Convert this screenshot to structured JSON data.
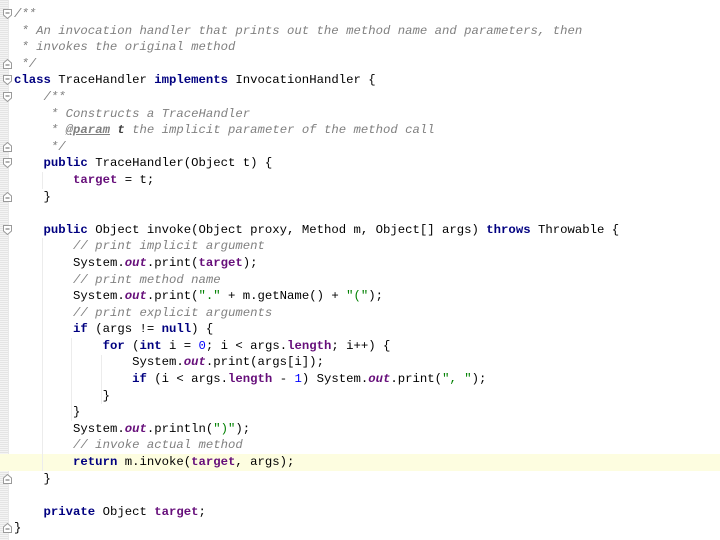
{
  "editor": {
    "language": "java",
    "highlighted_line": 27,
    "colors": {
      "keyword": "#000080",
      "field": "#660e7a",
      "comment": "#808080",
      "string": "#008000",
      "number": "#0000ff",
      "current_line": "#fdfde0"
    },
    "lines": [
      {
        "indent": 0,
        "fold": "open",
        "tokens": [
          {
            "t": "cmt",
            "v": "/**"
          }
        ]
      },
      {
        "indent": 0,
        "fold": "",
        "tokens": [
          {
            "t": "cmt",
            "v": " * An invocation handler that prints out the method name and parameters, then"
          }
        ]
      },
      {
        "indent": 0,
        "fold": "",
        "tokens": [
          {
            "t": "cmt",
            "v": " * invokes the original method"
          }
        ]
      },
      {
        "indent": 0,
        "fold": "close",
        "tokens": [
          {
            "t": "cmt",
            "v": " */"
          }
        ]
      },
      {
        "indent": 0,
        "fold": "open",
        "tokens": [
          {
            "t": "kw",
            "v": "class"
          },
          {
            "t": "",
            "v": " TraceHandler "
          },
          {
            "t": "kw",
            "v": "implements"
          },
          {
            "t": "",
            "v": " InvocationHandler {"
          }
        ]
      },
      {
        "indent": 1,
        "fold": "open",
        "tokens": [
          {
            "t": "cmt",
            "v": "/**"
          }
        ]
      },
      {
        "indent": 1,
        "fold": "",
        "tokens": [
          {
            "t": "cmt",
            "v": " * Constructs a TraceHandler"
          }
        ]
      },
      {
        "indent": 1,
        "fold": "",
        "tokens": [
          {
            "t": "cmt",
            "v": " * "
          },
          {
            "t": "doctag",
            "v": "@param"
          },
          {
            "t": "cmt",
            "v": " "
          },
          {
            "t": "docparam",
            "v": "t"
          },
          {
            "t": "cmt",
            "v": " the implicit parameter of the method call"
          }
        ]
      },
      {
        "indent": 1,
        "fold": "close",
        "tokens": [
          {
            "t": "cmt",
            "v": " */"
          }
        ]
      },
      {
        "indent": 1,
        "fold": "open",
        "tokens": [
          {
            "t": "kw",
            "v": "public"
          },
          {
            "t": "",
            "v": " TraceHandler(Object t) {"
          }
        ]
      },
      {
        "indent": 2,
        "fold": "",
        "tokens": [
          {
            "t": "field",
            "v": "target"
          },
          {
            "t": "",
            "v": " = t;"
          }
        ]
      },
      {
        "indent": 1,
        "fold": "close",
        "tokens": [
          {
            "t": "",
            "v": "}"
          }
        ]
      },
      {
        "indent": 0,
        "fold": "",
        "tokens": [
          {
            "t": "",
            "v": ""
          }
        ]
      },
      {
        "indent": 1,
        "fold": "open",
        "tokens": [
          {
            "t": "kw",
            "v": "public"
          },
          {
            "t": "",
            "v": " Object invoke(Object proxy, Method m, Object[] args) "
          },
          {
            "t": "kw",
            "v": "throws"
          },
          {
            "t": "",
            "v": " Throwable {"
          }
        ]
      },
      {
        "indent": 2,
        "fold": "",
        "tokens": [
          {
            "t": "cmt",
            "v": "// print implicit argument"
          }
        ]
      },
      {
        "indent": 2,
        "fold": "",
        "tokens": [
          {
            "t": "",
            "v": "System."
          },
          {
            "t": "static",
            "v": "out"
          },
          {
            "t": "",
            "v": ".print("
          },
          {
            "t": "field",
            "v": "target"
          },
          {
            "t": "",
            "v": ");"
          }
        ]
      },
      {
        "indent": 2,
        "fold": "",
        "tokens": [
          {
            "t": "cmt",
            "v": "// print method name"
          }
        ]
      },
      {
        "indent": 2,
        "fold": "",
        "tokens": [
          {
            "t": "",
            "v": "System."
          },
          {
            "t": "static",
            "v": "out"
          },
          {
            "t": "",
            "v": ".print("
          },
          {
            "t": "str",
            "v": "\".\""
          },
          {
            "t": "",
            "v": " + m.getName() + "
          },
          {
            "t": "str",
            "v": "\"(\""
          },
          {
            "t": "",
            "v": ");"
          }
        ]
      },
      {
        "indent": 2,
        "fold": "",
        "tokens": [
          {
            "t": "cmt",
            "v": "// print explicit arguments"
          }
        ]
      },
      {
        "indent": 2,
        "fold": "",
        "tokens": [
          {
            "t": "kw",
            "v": "if"
          },
          {
            "t": "",
            "v": " (args != "
          },
          {
            "t": "kw",
            "v": "null"
          },
          {
            "t": "",
            "v": ") {"
          }
        ]
      },
      {
        "indent": 3,
        "fold": "",
        "tokens": [
          {
            "t": "kw",
            "v": "for"
          },
          {
            "t": "",
            "v": " ("
          },
          {
            "t": "kw",
            "v": "int"
          },
          {
            "t": "",
            "v": " i = "
          },
          {
            "t": "num",
            "v": "0"
          },
          {
            "t": "",
            "v": "; i < args."
          },
          {
            "t": "field",
            "v": "length"
          },
          {
            "t": "",
            "v": "; i++) {"
          }
        ]
      },
      {
        "indent": 4,
        "fold": "",
        "tokens": [
          {
            "t": "",
            "v": "System."
          },
          {
            "t": "static",
            "v": "out"
          },
          {
            "t": "",
            "v": ".print(args[i]);"
          }
        ]
      },
      {
        "indent": 4,
        "fold": "",
        "tokens": [
          {
            "t": "kw",
            "v": "if"
          },
          {
            "t": "",
            "v": " (i < args."
          },
          {
            "t": "field",
            "v": "length"
          },
          {
            "t": "",
            "v": " - "
          },
          {
            "t": "num",
            "v": "1"
          },
          {
            "t": "",
            "v": ") System."
          },
          {
            "t": "static",
            "v": "out"
          },
          {
            "t": "",
            "v": ".print("
          },
          {
            "t": "str",
            "v": "\", \""
          },
          {
            "t": "",
            "v": ");"
          }
        ]
      },
      {
        "indent": 3,
        "fold": "",
        "tokens": [
          {
            "t": "",
            "v": "}"
          }
        ]
      },
      {
        "indent": 2,
        "fold": "",
        "tokens": [
          {
            "t": "",
            "v": "}"
          }
        ]
      },
      {
        "indent": 2,
        "fold": "",
        "tokens": [
          {
            "t": "",
            "v": "System."
          },
          {
            "t": "static",
            "v": "out"
          },
          {
            "t": "",
            "v": ".println("
          },
          {
            "t": "str",
            "v": "\")\""
          },
          {
            "t": "",
            "v": ");"
          }
        ]
      },
      {
        "indent": 2,
        "fold": "",
        "tokens": [
          {
            "t": "cmt",
            "v": "// invoke actual method"
          }
        ]
      },
      {
        "indent": 2,
        "fold": "",
        "tokens": [
          {
            "t": "kw",
            "v": "return"
          },
          {
            "t": "",
            "v": " m.invoke("
          },
          {
            "t": "field",
            "v": "target"
          },
          {
            "t": "",
            "v": ", args);"
          }
        ]
      },
      {
        "indent": 1,
        "fold": "close",
        "tokens": [
          {
            "t": "",
            "v": "}"
          }
        ]
      },
      {
        "indent": 0,
        "fold": "",
        "tokens": [
          {
            "t": "",
            "v": ""
          }
        ]
      },
      {
        "indent": 1,
        "fold": "",
        "tokens": [
          {
            "t": "kw",
            "v": "private"
          },
          {
            "t": "",
            "v": " Object "
          },
          {
            "t": "field",
            "v": "target"
          },
          {
            "t": "",
            "v": ";"
          }
        ]
      },
      {
        "indent": 0,
        "fold": "close",
        "tokens": [
          {
            "t": "",
            "v": "}"
          }
        ]
      }
    ]
  }
}
